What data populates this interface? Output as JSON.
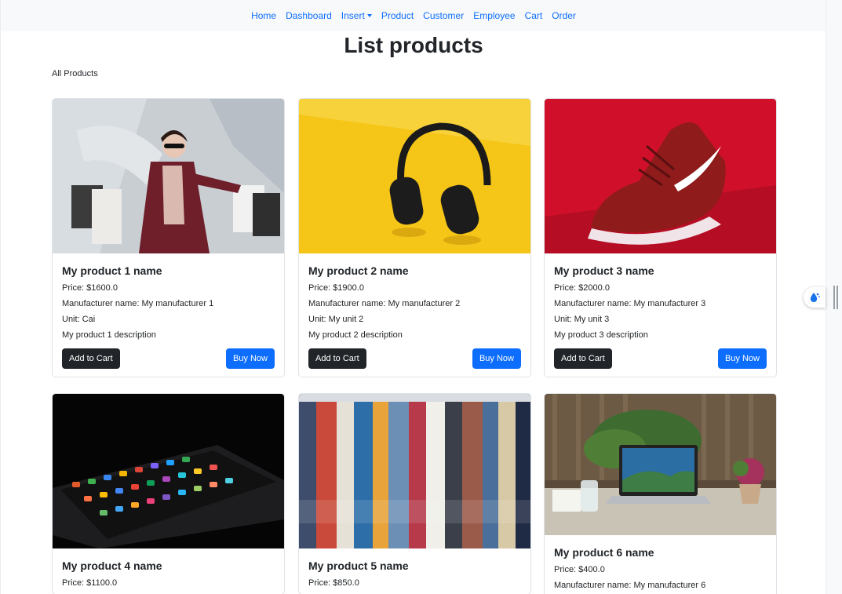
{
  "nav": {
    "items": [
      "Home",
      "Dashboard",
      "Insert",
      "Product",
      "Customer",
      "Employee",
      "Cart",
      "Order"
    ]
  },
  "page": {
    "title": "List products",
    "subtitle": "All Products"
  },
  "labels": {
    "add_to_cart": "Add to Cart",
    "buy_now": "Buy Now"
  },
  "products": [
    {
      "name": "My product 1 name",
      "price": "Price: $1600.0",
      "manufacturer": "Manufacturer name: My manufacturer 1",
      "unit": "Unit: Cai",
      "description": "My product 1 description",
      "image": "shopping-woman-photo"
    },
    {
      "name": "My product 2 name",
      "price": "Price: $1900.0",
      "manufacturer": "Manufacturer name: My manufacturer 2",
      "unit": "Unit: My unit 2",
      "description": "My product 2 description",
      "image": "headphones-photo"
    },
    {
      "name": "My product 3 name",
      "price": "Price: $2000.0",
      "manufacturer": "Manufacturer name: My manufacturer 3",
      "unit": "Unit: My unit 3",
      "description": "My product 3 description",
      "image": "sneaker-photo"
    },
    {
      "name": "My product 4 name",
      "price": "Price: $1100.0",
      "image": "smartphone-photo"
    },
    {
      "name": "My product 5 name",
      "price": "Price: $850.0",
      "image": "clothes-rack-photo"
    },
    {
      "name": "My product 6 name",
      "price": "Price: $400.0",
      "manufacturer": "Manufacturer name: My manufacturer 6",
      "image": "laptop-desk-photo"
    }
  ],
  "colors": {
    "primary": "#0d6efd",
    "dark": "#212529",
    "navbar": "#f8f9fa"
  }
}
